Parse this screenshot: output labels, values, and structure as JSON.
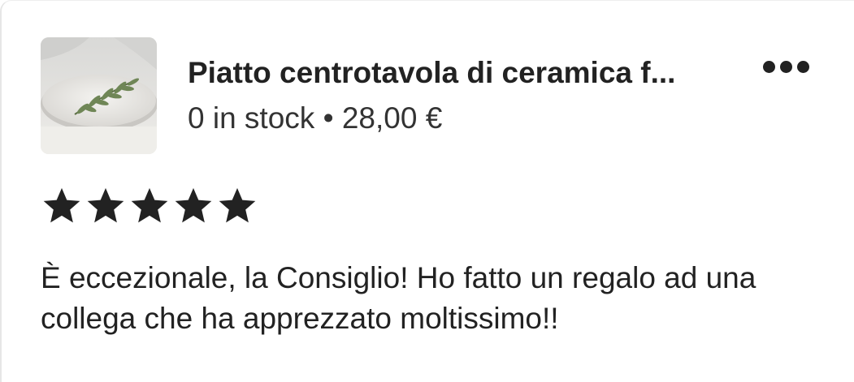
{
  "listing": {
    "thumbnail_alt": "plate-with-olive-branch-image",
    "title": "Piatto centrotavola di ceramica f...",
    "stock_text": "0 in stock",
    "separator": "•",
    "price": "28,00 €"
  },
  "actions": {
    "more_icon": "more-horizontal-icon"
  },
  "rating": {
    "stars": 5,
    "max": 5,
    "star_icon": "star-icon",
    "star_color": "#222222"
  },
  "review": {
    "text": "È eccezionale, la Consiglio! Ho fatto un regalo ad una collega che ha apprezzato moltissimo!!"
  }
}
